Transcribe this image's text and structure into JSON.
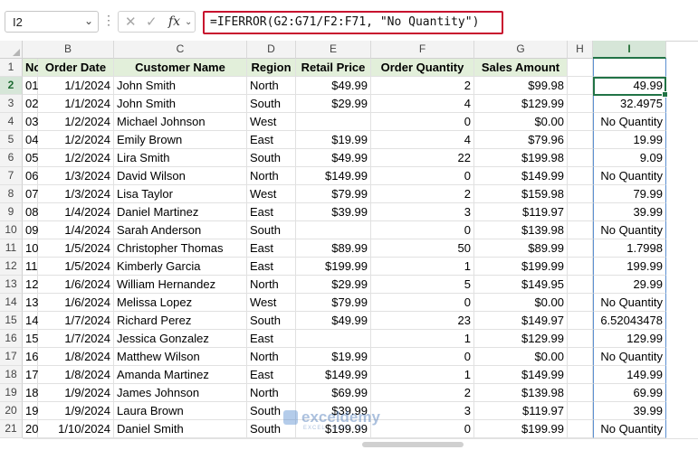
{
  "formula_bar": {
    "name_box": "I2",
    "formula": "=IFERROR(G2:G71/F2:F71, \"No Quantity\")"
  },
  "columns": [
    "B",
    "C",
    "D",
    "E",
    "F",
    "G",
    "H",
    "I"
  ],
  "header_row": {
    "row_number": "1",
    "cells": [
      "No",
      "Order Date",
      "Customer Name",
      "Region",
      "Retail Price",
      "Order Quantity",
      "Sales Amount",
      "",
      ""
    ]
  },
  "rows": [
    {
      "n": "2",
      "a": "01",
      "b": "1/1/2024",
      "c": "John Smith",
      "d": "North",
      "e": "$49.99",
      "f": "2",
      "g": "$99.98",
      "h": "",
      "i": "49.99"
    },
    {
      "n": "3",
      "a": "02",
      "b": "1/1/2024",
      "c": "John Smith",
      "d": "South",
      "e": "$29.99",
      "f": "4",
      "g": "$129.99",
      "h": "",
      "i": "32.4975"
    },
    {
      "n": "4",
      "a": "03",
      "b": "1/2/2024",
      "c": "Michael Johnson",
      "d": "West",
      "e": "",
      "f": "0",
      "g": "$0.00",
      "h": "",
      "i": "No Quantity"
    },
    {
      "n": "5",
      "a": "04",
      "b": "1/2/2024",
      "c": "Emily Brown",
      "d": "East",
      "e": "$19.99",
      "f": "4",
      "g": "$79.96",
      "h": "",
      "i": "19.99"
    },
    {
      "n": "6",
      "a": "05",
      "b": "1/2/2024",
      "c": "Lira Smith",
      "d": "South",
      "e": "$49.99",
      "f": "22",
      "g": "$199.98",
      "h": "",
      "i": "9.09"
    },
    {
      "n": "7",
      "a": "06",
      "b": "1/3/2024",
      "c": "David Wilson",
      "d": "North",
      "e": "$149.99",
      "f": "0",
      "g": "$149.99",
      "h": "",
      "i": "No Quantity"
    },
    {
      "n": "8",
      "a": "07",
      "b": "1/3/2024",
      "c": "Lisa Taylor",
      "d": "West",
      "e": "$79.99",
      "f": "2",
      "g": "$159.98",
      "h": "",
      "i": "79.99"
    },
    {
      "n": "9",
      "a": "08",
      "b": "1/4/2024",
      "c": "Daniel Martinez",
      "d": "East",
      "e": "$39.99",
      "f": "3",
      "g": "$119.97",
      "h": "",
      "i": "39.99"
    },
    {
      "n": "10",
      "a": "09",
      "b": "1/4/2024",
      "c": "Sarah Anderson",
      "d": "South",
      "e": "",
      "f": "0",
      "g": "$139.98",
      "h": "",
      "i": "No Quantity"
    },
    {
      "n": "11",
      "a": "10",
      "b": "1/5/2024",
      "c": "Christopher Thomas",
      "d": "East",
      "e": "$89.99",
      "f": "50",
      "g": "$89.99",
      "h": "",
      "i": "1.7998"
    },
    {
      "n": "12",
      "a": "11",
      "b": "1/5/2024",
      "c": "Kimberly Garcia",
      "d": "East",
      "e": "$199.99",
      "f": "1",
      "g": "$199.99",
      "h": "",
      "i": "199.99"
    },
    {
      "n": "13",
      "a": "12",
      "b": "1/6/2024",
      "c": "William Hernandez",
      "d": "North",
      "e": "$29.99",
      "f": "5",
      "g": "$149.95",
      "h": "",
      "i": "29.99"
    },
    {
      "n": "14",
      "a": "13",
      "b": "1/6/2024",
      "c": "Melissa Lopez",
      "d": "West",
      "e": "$79.99",
      "f": "0",
      "g": "$0.00",
      "h": "",
      "i": "No Quantity"
    },
    {
      "n": "15",
      "a": "14",
      "b": "1/7/2024",
      "c": "Richard Perez",
      "d": "South",
      "e": "$49.99",
      "f": "23",
      "g": "$149.97",
      "h": "",
      "i": "6.52043478"
    },
    {
      "n": "16",
      "a": "15",
      "b": "1/7/2024",
      "c": "Jessica Gonzalez",
      "d": "East",
      "e": "",
      "f": "1",
      "g": "$129.99",
      "h": "",
      "i": "129.99"
    },
    {
      "n": "17",
      "a": "16",
      "b": "1/8/2024",
      "c": "Matthew Wilson",
      "d": "North",
      "e": "$19.99",
      "f": "0",
      "g": "$0.00",
      "h": "",
      "i": "No Quantity"
    },
    {
      "n": "18",
      "a": "17",
      "b": "1/8/2024",
      "c": "Amanda Martinez",
      "d": "East",
      "e": "$149.99",
      "f": "1",
      "g": "$149.99",
      "h": "",
      "i": "149.99"
    },
    {
      "n": "19",
      "a": "18",
      "b": "1/9/2024",
      "c": "James Johnson",
      "d": "North",
      "e": "$69.99",
      "f": "2",
      "g": "$139.98",
      "h": "",
      "i": "69.99"
    },
    {
      "n": "20",
      "a": "19",
      "b": "1/9/2024",
      "c": "Laura Brown",
      "d": "South",
      "e": "$39.99",
      "f": "3",
      "g": "$119.97",
      "h": "",
      "i": "39.99"
    },
    {
      "n": "21",
      "a": "20",
      "b": "1/10/2024",
      "c": "Daniel Smith",
      "d": "South",
      "e": "$199.99",
      "f": "0",
      "g": "$199.99",
      "h": "",
      "i": "No Quantity"
    }
  ],
  "watermark": {
    "name": "exceldemy",
    "tagline": "EXCEL · DATA · BI"
  },
  "colors": {
    "accent": "#217346",
    "header_fill": "#e2efda",
    "formula_highlight": "#c8102e",
    "selection_border": "#5b8fd1"
  }
}
